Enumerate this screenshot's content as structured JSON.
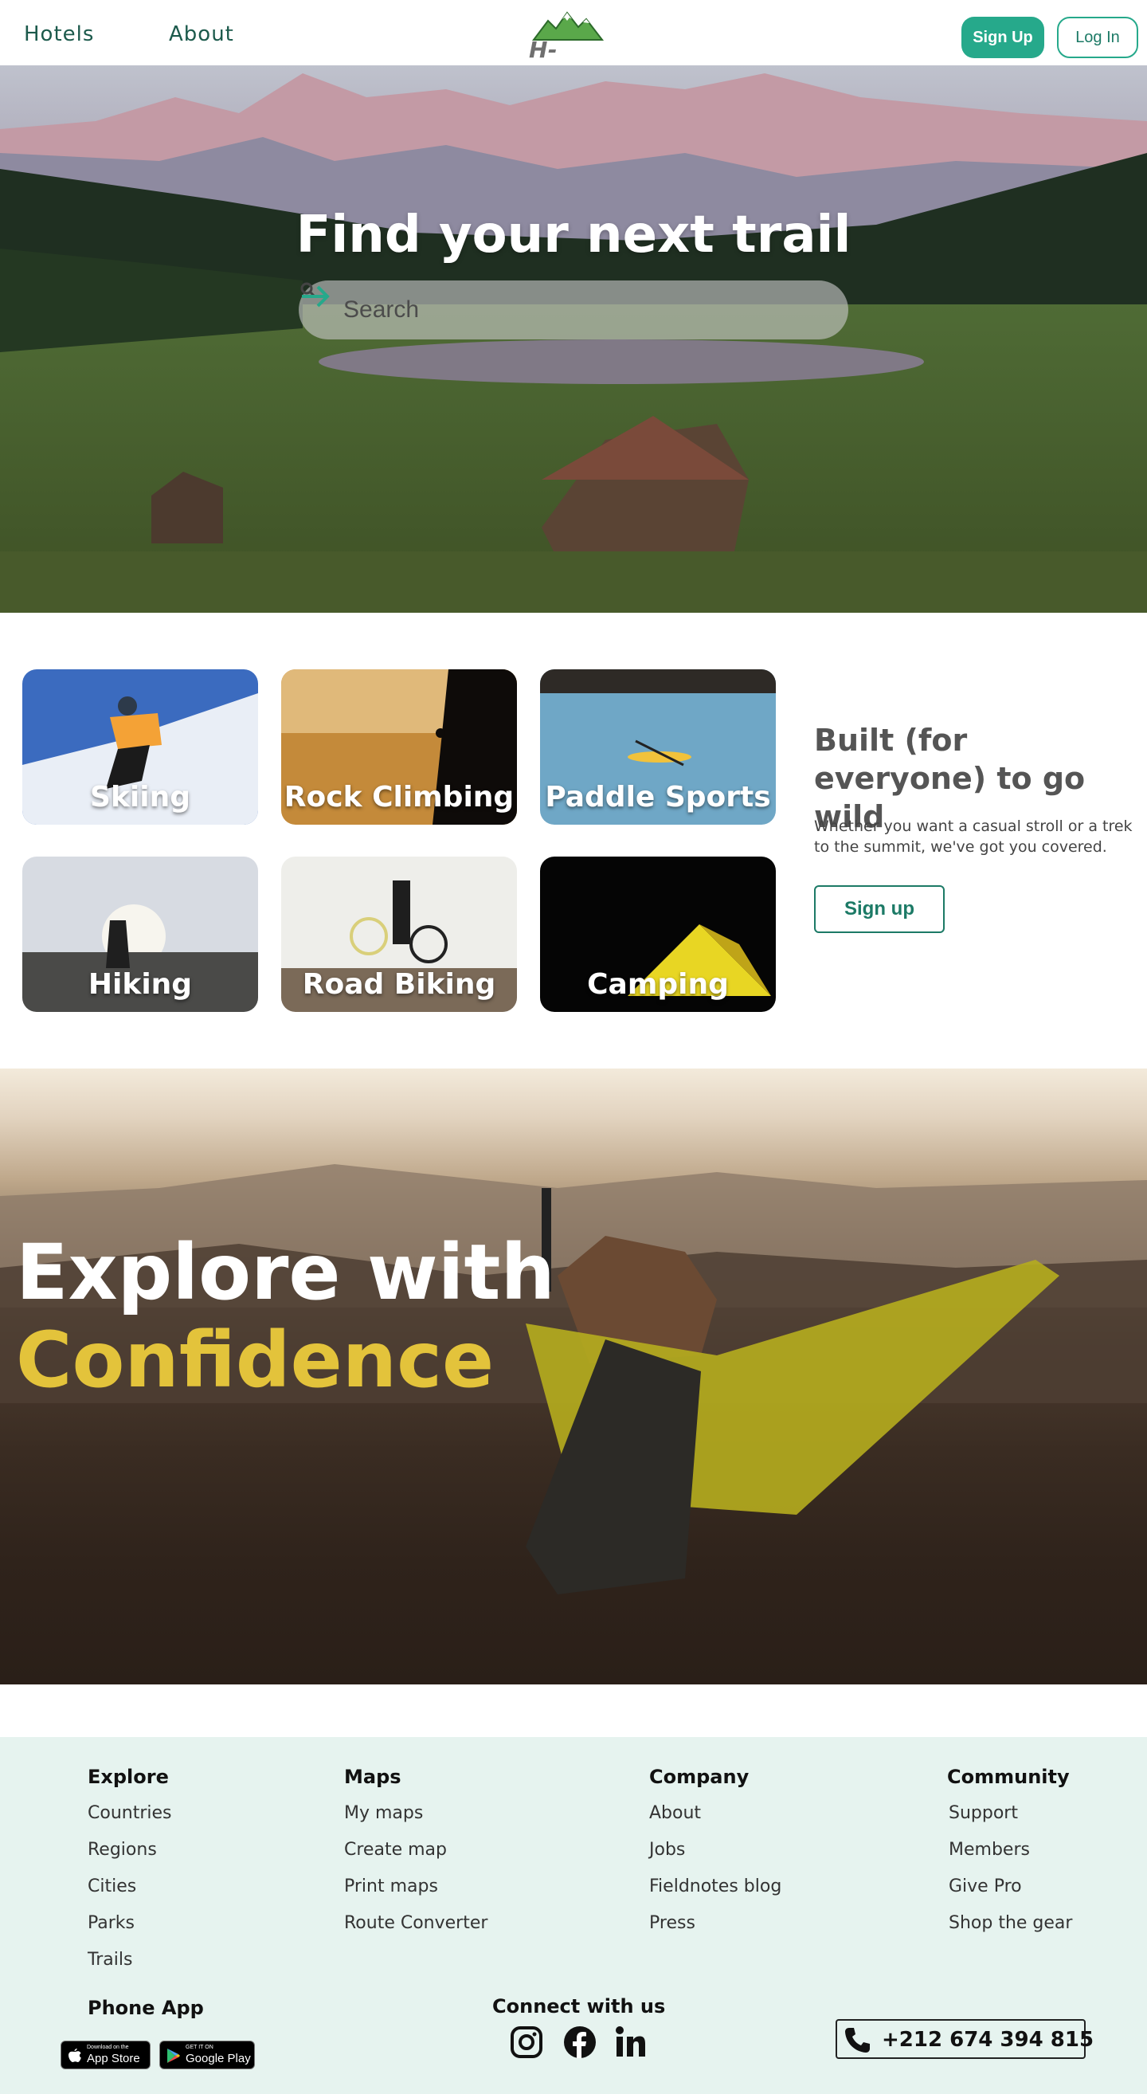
{
  "nav": {
    "links": [
      "Hotels",
      "About"
    ],
    "logo_text": "H-Agency",
    "signup_label": "Sign Up",
    "login_label": "Log In"
  },
  "hero": {
    "title": "Find your next trail",
    "search_placeholder": "Search"
  },
  "activities": {
    "cards": [
      "Skiing",
      "Rock Climbing",
      "Paddle Sports",
      "Hiking",
      "Road Biking",
      "Camping"
    ],
    "title": "Built (for everyone) to go wild",
    "description": "Whether you want a casual stroll or a trek to the summit, we've got you covered.",
    "button_label": "Sign up"
  },
  "explore": {
    "line1": "Explore with",
    "line2": "Confidence"
  },
  "footer": {
    "columns": [
      {
        "title": "Explore",
        "items": [
          "Countries",
          "Regions",
          "Cities",
          "Parks",
          "Trails"
        ]
      },
      {
        "title": "Maps",
        "items": [
          "My maps",
          "Create map",
          "Print maps",
          "Route Converter"
        ]
      },
      {
        "title": "Company",
        "items": [
          "About",
          "Jobs",
          "Fieldnotes blog",
          "Press"
        ]
      },
      {
        "title": "Community",
        "items": [
          "Support",
          "Members",
          "Give Pro",
          "Shop the gear"
        ]
      }
    ],
    "phone_app_title": "Phone App",
    "app_store": {
      "small": "Download on the",
      "big": "App Store"
    },
    "play_store": {
      "small": "GET IT ON",
      "big": "Google Play"
    },
    "connect_title": "Connect with us",
    "social_icons": [
      "instagram-icon",
      "facebook-icon",
      "linkedin-icon"
    ],
    "phone_number": "+212 674 394 815"
  },
  "colors": {
    "accent": "#26a98b",
    "accent_dark": "#1c7a66",
    "highlight": "#e3c33b",
    "footer_bg": "#e6f3ef"
  }
}
